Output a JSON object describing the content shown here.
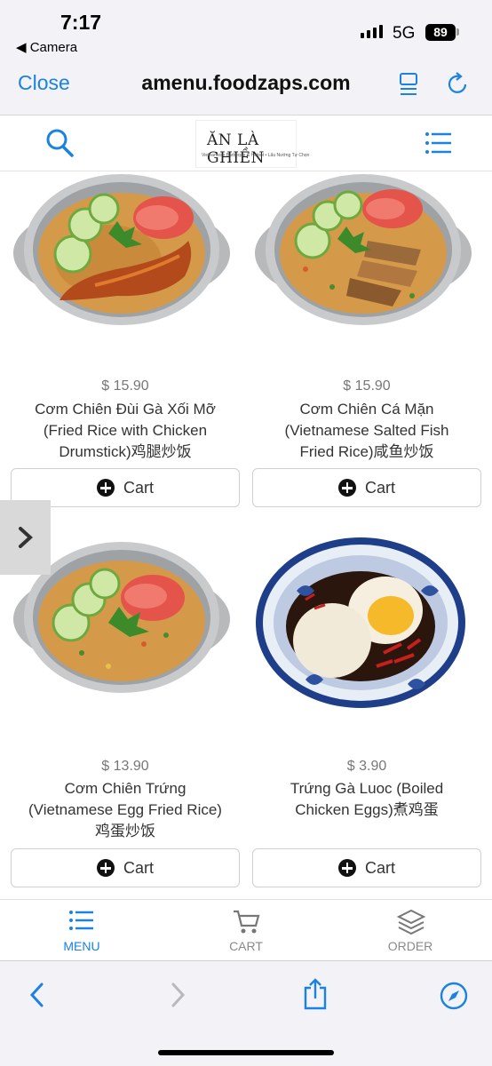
{
  "status": {
    "time": "7:17",
    "back_label": "◀ Camera",
    "network": "5G",
    "battery": "89"
  },
  "browser": {
    "close_label": "Close",
    "url": "amenu.foodzaps.com"
  },
  "site": {
    "logo_text": "ĂN LÀ GHIỀN",
    "logo_subtitle": "Vietnamese Barbeque & Hotpot • Lẩu Nướng Tự Chọn"
  },
  "products": [
    {
      "price": "$ 15.90",
      "name_line1": "Cơm Chiên Đùi Gà Xối Mỡ",
      "name_line2": "(Fried Rice with Chicken",
      "name_line3": "Drumstick)鸡腿炒饭",
      "cart_label": "Cart",
      "image": "fried-rice-drumstick"
    },
    {
      "price": "$ 15.90",
      "name_line1": "Cơm Chiên Cá Mặn",
      "name_line2": "(Vietnamese Salted Fish",
      "name_line3": "Fried Rice)咸鱼炒饭",
      "cart_label": "Cart",
      "image": "fried-rice-salted-fish"
    },
    {
      "price": "$ 13.90",
      "name_line1": "Cơm Chiên Trứng",
      "name_line2": "(Vietnamese Egg Fried Rice)",
      "name_line3": "鸡蛋炒饭",
      "cart_label": "Cart",
      "image": "egg-fried-rice"
    },
    {
      "price": "$ 3.90",
      "name_line1": "Trứng Gà Luoc (Boiled",
      "name_line2": "Chicken Eggs)煮鸡蛋",
      "name_line3": "",
      "cart_label": "Cart",
      "image": "boiled-eggs"
    }
  ],
  "tabs": [
    {
      "label": "MENU",
      "icon": "list-icon",
      "active": true
    },
    {
      "label": "CART",
      "icon": "cart-icon",
      "active": false
    },
    {
      "label": "ORDER",
      "icon": "layers-icon",
      "active": false
    }
  ],
  "colors": {
    "accent": "#1a82e2",
    "tab_active": "#1a82e2",
    "tab_inactive": "#8a8a8a"
  }
}
